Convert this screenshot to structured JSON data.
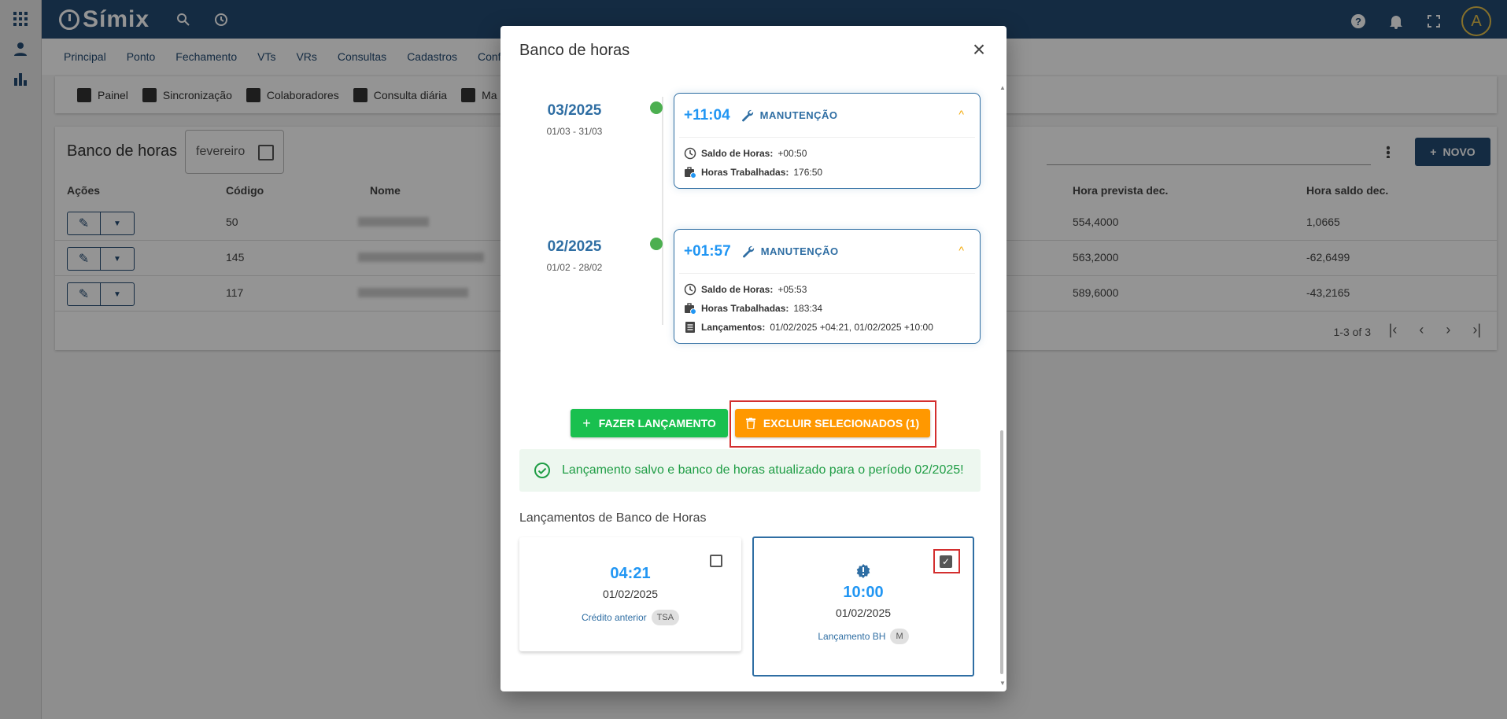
{
  "app": {
    "brand": "Símix",
    "avatar_letter": "A",
    "menu": [
      "Principal",
      "Ponto",
      "Fechamento",
      "VTs",
      "VRs",
      "Consultas",
      "Cadastros",
      "Config"
    ],
    "submenu": [
      "Painel",
      "Sincronização",
      "Colaboradores",
      "Consulta diária",
      "Ma"
    ],
    "page_title": "Banco de horas",
    "month_value": "fevereiro",
    "new_button": "NOVO",
    "columns": {
      "acoes": "Ações",
      "codigo": "Código",
      "nome": "Nome",
      "hora_prevista": "Hora prevista dec.",
      "hora_saldo": "Hora saldo dec."
    },
    "rows": [
      {
        "codigo": "50",
        "hora_prevista": "554,4000",
        "hora_saldo": "1,0665"
      },
      {
        "codigo": "145",
        "hora_prevista": "563,2000",
        "hora_saldo": "-62,6499"
      },
      {
        "codigo": "117",
        "hora_prevista": "589,6000",
        "hora_saldo": "-43,2165"
      }
    ],
    "pagination": "1-3 of 3"
  },
  "modal": {
    "title": "Banco de horas",
    "periods": [
      {
        "period": "03/2025",
        "range": "01/03 - 31/03",
        "balance": "+11:04",
        "tag": "MANUTENÇÃO",
        "saldo_label": "Saldo de Horas:",
        "saldo_value": "+00:50",
        "trab_label": "Horas Trabalhadas:",
        "trab_value": "176:50"
      },
      {
        "period": "02/2025",
        "range": "01/02 - 28/02",
        "balance": "+01:57",
        "tag": "MANUTENÇÃO",
        "saldo_label": "Saldo de Horas:",
        "saldo_value": "+05:53",
        "trab_label": "Horas Trabalhadas:",
        "trab_value": "183:34",
        "lanc_label": "Lançamentos:",
        "lanc_value": "01/02/2025 +04:21, 01/02/2025 +10:00"
      }
    ],
    "btn_fazer": "FAZER LANÇAMENTO",
    "btn_excluir": "EXCLUIR SELECIONADOS (1)",
    "alert": "Lançamento salvo e banco de horas atualizado para o período 02/2025!",
    "section_title": "Lançamentos de Banco de Horas",
    "entries": [
      {
        "time": "04:21",
        "date": "01/02/2025",
        "desc": "Crédito anterior",
        "chip": "TSA",
        "checked": false
      },
      {
        "time": "10:00",
        "date": "01/02/2025",
        "desc": "Lançamento BH",
        "chip": "M",
        "checked": true
      }
    ]
  },
  "colors": {
    "primary": "#244a73",
    "accent_blue": "#2196f3",
    "green": "#19c04f",
    "orange": "#ff9800",
    "highlight": "#d32f2f"
  }
}
